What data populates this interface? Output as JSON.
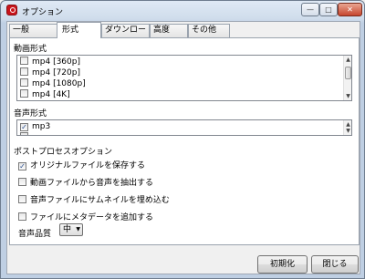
{
  "window": {
    "title": "オプション",
    "buttons": {
      "minimize": "—",
      "maximize": "□",
      "close": "✕"
    }
  },
  "tabs": [
    "一般",
    "形式",
    "ダウンロード",
    "高度",
    "その他"
  ],
  "active_tab": "形式",
  "video": {
    "heading": "動画形式",
    "items": [
      {
        "label": "mp4 [360p]",
        "checked": false
      },
      {
        "label": "mp4 [720p]",
        "checked": false
      },
      {
        "label": "mp4 [1080p]",
        "checked": false
      },
      {
        "label": "mp4 [4K]",
        "checked": false
      }
    ]
  },
  "audio": {
    "heading": "音声形式",
    "items": [
      {
        "label": "mp3",
        "checked": true
      },
      {
        "label": "",
        "checked": false
      }
    ]
  },
  "postprocess": {
    "heading": "ポストプロセスオプション",
    "options": [
      {
        "label": "オリジナルファイルを保存する",
        "checked": true
      },
      {
        "label": "動画ファイルから音声を抽出する",
        "checked": false
      },
      {
        "label": "音声ファイルにサムネイルを埋め込む",
        "checked": false
      },
      {
        "label": "ファイルにメタデータを追加する",
        "checked": false
      }
    ],
    "quality_label": "音声品質",
    "quality_value": "中"
  },
  "footer": {
    "reset": "初期化",
    "close": "閉じる"
  },
  "icons": {
    "check": "✓",
    "up": "▲",
    "down": "▼",
    "dropdown": "▼"
  }
}
